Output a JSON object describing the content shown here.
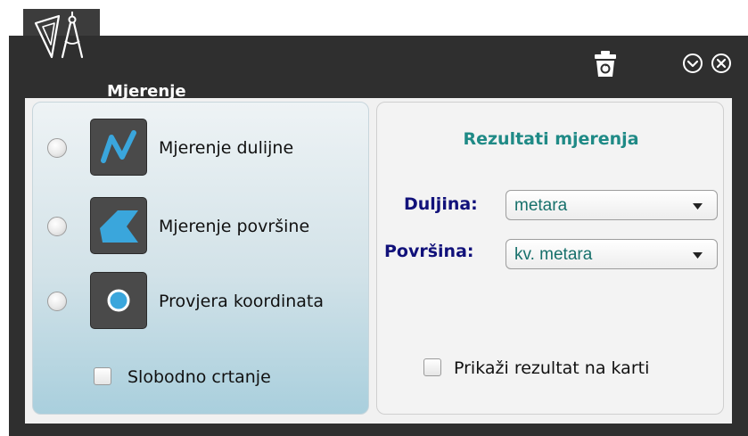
{
  "window": {
    "title": "Mjerenje"
  },
  "icons": {
    "app": "compass-ruler-icon",
    "trash": "recycle-bin-icon",
    "collapse": "chevron-down-circle-icon",
    "close": "close-circle-icon"
  },
  "tools": [
    {
      "label": "Mjerenje dulijne",
      "icon": "line-measure-icon"
    },
    {
      "label": "Mjerenje površine",
      "icon": "area-measure-icon"
    },
    {
      "label": "Provjera koordinata",
      "icon": "point-coordinate-icon"
    }
  ],
  "freehand": {
    "label": "Slobodno crtanje",
    "checked": false
  },
  "results": {
    "title": "Rezultati mjerenja",
    "length_label": "Duljina:",
    "length_unit": "metara",
    "area_label": "Površina:",
    "area_unit": "kv. metara",
    "show_on_map_label": "Prikaži rezultat na karti",
    "show_on_map_checked": false
  },
  "colors": {
    "window_bg": "#2f2f2f",
    "accent_teal": "#1f8a86",
    "label_navy": "#11117a",
    "icon_blue": "#3aa6dc"
  }
}
